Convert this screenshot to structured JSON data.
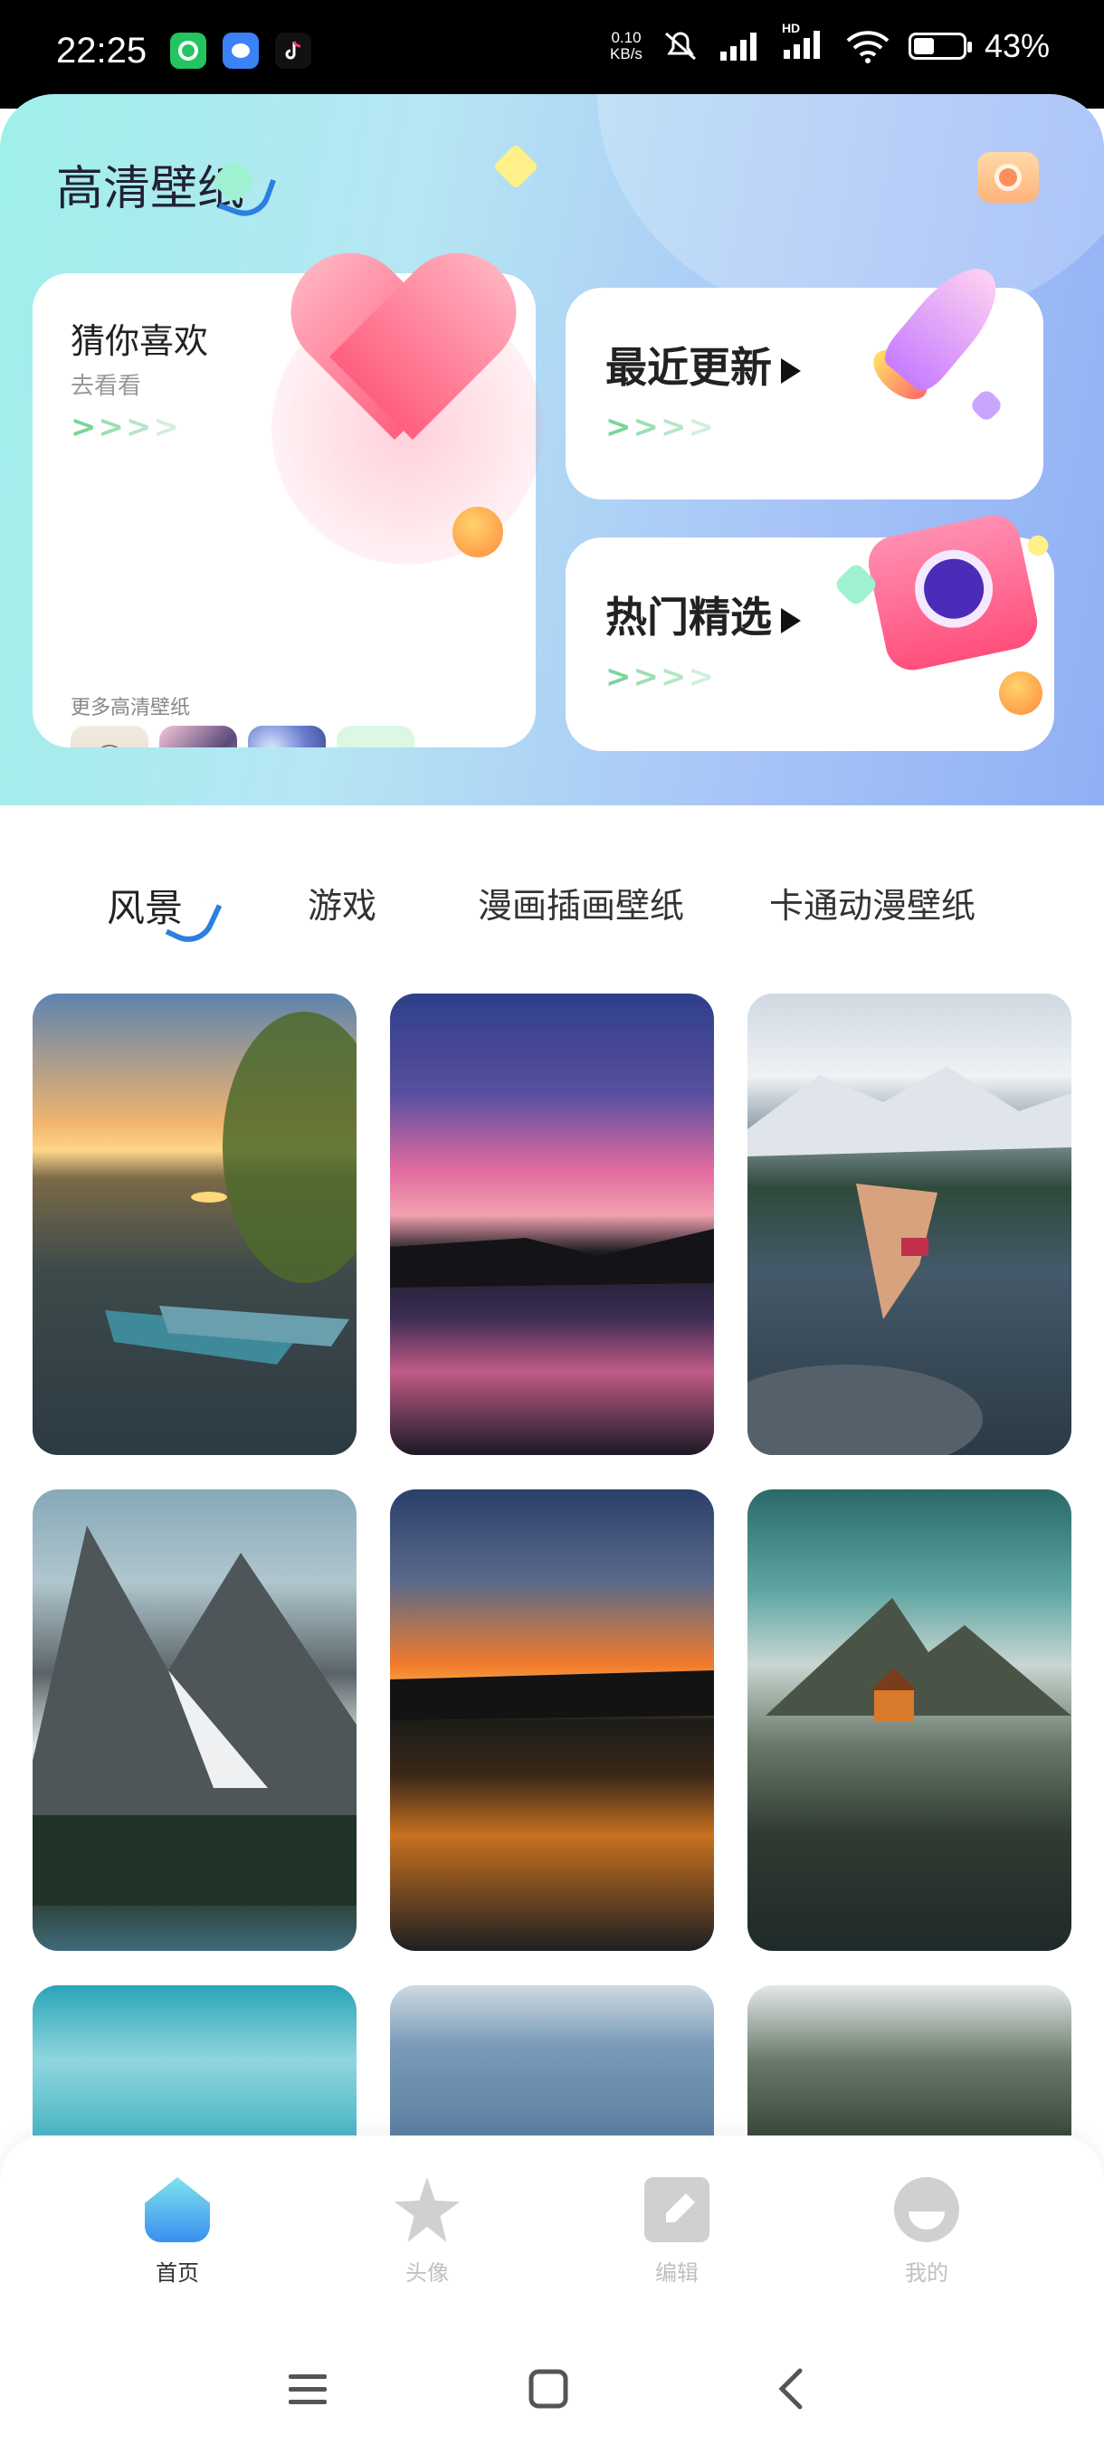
{
  "status_bar": {
    "time": "22:25",
    "net_speed_value": "0.10",
    "net_speed_unit": "KB/s",
    "network_label": "HD",
    "battery_percent": "43%",
    "battery_level": 0.43,
    "icons": [
      "app-green-icon",
      "app-blue-icon",
      "tiktok-icon",
      "mute-icon",
      "signal-icon",
      "signal-hd-icon",
      "wifi-icon",
      "battery-icon"
    ]
  },
  "header": {
    "title": "高清壁纸",
    "camera_icon": "camera-icon",
    "guess_card": {
      "title": "猜你喜欢",
      "subtitle": "去看看",
      "more_label": "更多高清壁纸",
      "arrow_glyph": ">"
    },
    "latest_card": {
      "title": "最近更新"
    },
    "hot_card": {
      "title": "热门精选"
    }
  },
  "tabs": [
    "风景",
    "游戏",
    "漫画插画壁纸",
    "卡通动漫壁纸"
  ],
  "active_tab_index": 0,
  "wallpapers": [
    {
      "name": "sunset-lake-boats"
    },
    {
      "name": "pink-cloud-lake"
    },
    {
      "name": "diver-mountain-lake"
    },
    {
      "name": "snowy-peaks-forest"
    },
    {
      "name": "orange-sunset-water"
    },
    {
      "name": "mountain-house-reflection"
    },
    {
      "name": "sky-clouds-teal"
    },
    {
      "name": "calm-water"
    },
    {
      "name": "misty-forest-waterfall"
    }
  ],
  "bottom_nav": [
    {
      "label": "首页",
      "icon": "home-icon",
      "active": true
    },
    {
      "label": "头像",
      "icon": "star-icon",
      "active": false
    },
    {
      "label": "编辑",
      "icon": "edit-icon",
      "active": false
    },
    {
      "label": "我的",
      "icon": "profile-icon",
      "active": false
    }
  ],
  "colors": {
    "accent": "#2a7fe0",
    "arrow_green": "#7dd39a",
    "header_gradient": [
      "#9ff0ea",
      "#8fb0f5"
    ]
  }
}
